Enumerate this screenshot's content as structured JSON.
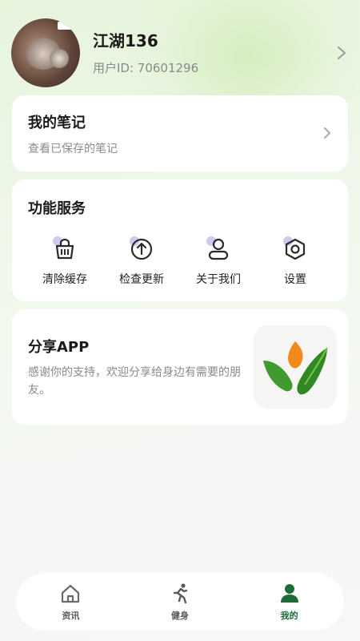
{
  "profile": {
    "name": "江湖136",
    "user_id": "用户ID: 70601296"
  },
  "notes_card": {
    "title": "我的笔记",
    "subtitle": "查看已保存的笔记"
  },
  "services_card": {
    "title": "功能服务",
    "items": [
      {
        "label": "清除缓存",
        "icon": "basket-icon"
      },
      {
        "label": "检查更新",
        "icon": "upload-arrow-icon"
      },
      {
        "label": "关于我们",
        "icon": "person-icon"
      },
      {
        "label": "设置",
        "icon": "settings-hexagon-icon"
      }
    ]
  },
  "share_card": {
    "title": "分享APP",
    "subtitle": "感谢你的支持，欢迎分享给身边有需要的朋友。"
  },
  "tabbar": {
    "items": [
      {
        "label": "资讯",
        "icon": "home-icon",
        "active": false
      },
      {
        "label": "健身",
        "icon": "running-icon",
        "active": false
      },
      {
        "label": "我的",
        "icon": "user-icon",
        "active": true
      }
    ]
  },
  "colors": {
    "accent": "#1e6b3a",
    "icon_dot": "#cfc9f0",
    "logo_orange": "#f08a1c",
    "logo_green": "#3f9a2f"
  }
}
